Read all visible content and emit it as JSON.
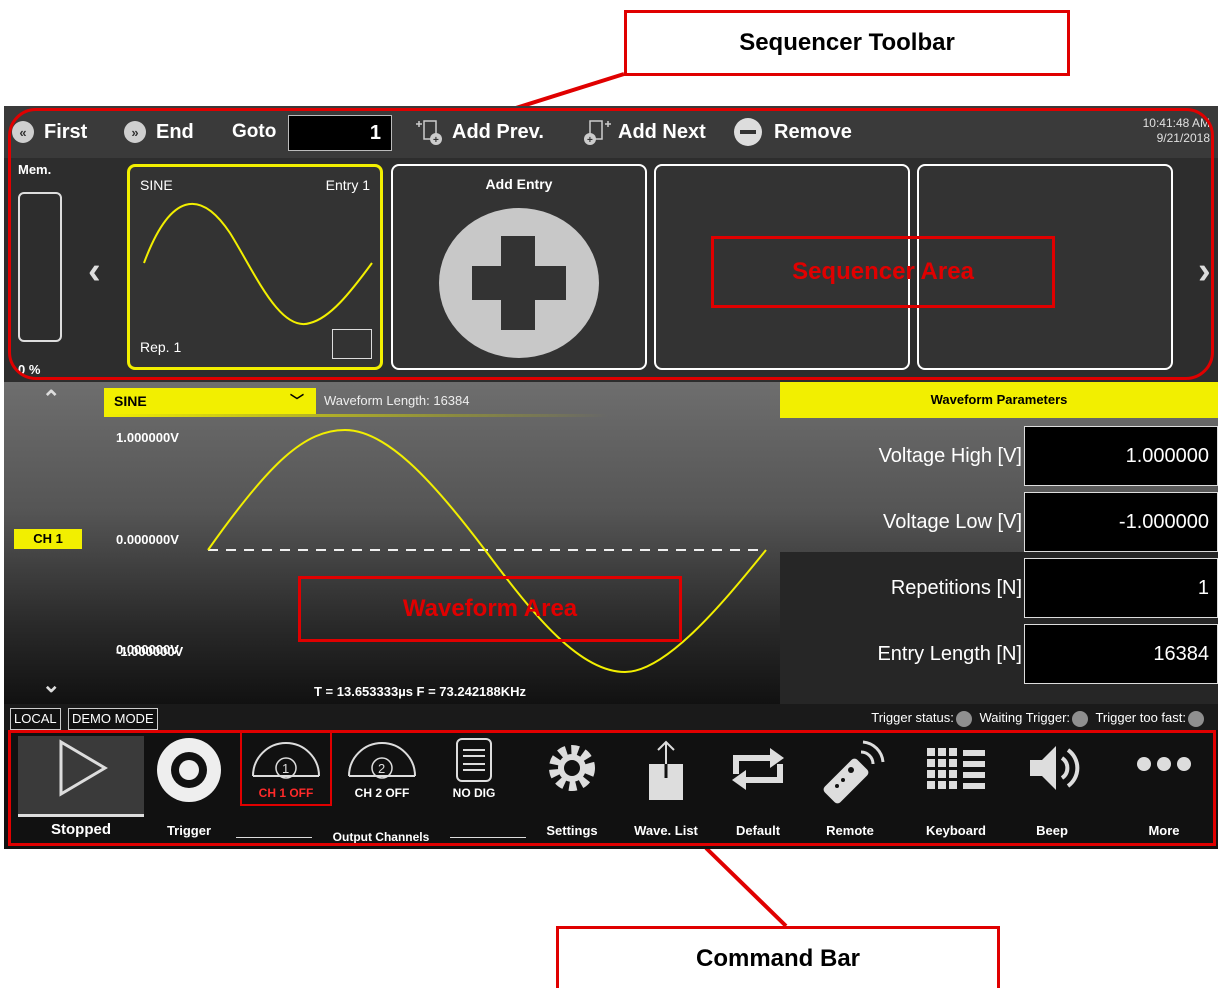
{
  "callouts": {
    "top": "Sequencer Toolbar",
    "bottom": "Command Bar",
    "sequencer_area": "Sequencer Area",
    "waveform_area": "Waveform Area"
  },
  "toolbar": {
    "first": "First",
    "end": "End",
    "goto_label": "Goto",
    "goto_value": "1",
    "add_prev": "Add Prev.",
    "add_next": "Add Next",
    "remove": "Remove",
    "time": "10:41:48 AM",
    "date": "9/21/2018"
  },
  "sequencer": {
    "mem_label": "Mem.",
    "mem_percent": "0 %",
    "entry_type": "SINE",
    "entry_name": "Entry 1",
    "entry_rep": "Rep. 1",
    "add_entry": "Add Entry"
  },
  "waveform": {
    "type": "SINE",
    "length_text": "Waveform Length: 16384",
    "v_high": "1.000000V",
    "v_zero": "0.000000V",
    "v_low": "-1.000000V",
    "channel": "CH 1",
    "period_freq": "T =  13.653333µs  F =  73.242188KHz"
  },
  "params": {
    "header": "Waveform Parameters",
    "rows": [
      {
        "label": "Voltage High [V]",
        "value": "1.000000"
      },
      {
        "label": "Voltage Low [V]",
        "value": "-1.000000"
      },
      {
        "label": "Repetitions [N]",
        "value": "1"
      },
      {
        "label": "Entry Length [N]",
        "value": "16384"
      }
    ]
  },
  "status": {
    "local": "LOCAL",
    "demo": "DEMO MODE",
    "trigger_status": "Trigger status:",
    "waiting": "Waiting Trigger:",
    "too_fast": "Trigger too fast:"
  },
  "command_bar": {
    "stopped": "Stopped",
    "trigger": "Trigger",
    "ch1_num": "1",
    "ch1": "CH 1 OFF",
    "ch2_num": "2",
    "ch2": "CH 2 OFF",
    "nodig": "NO DIG",
    "output_channels": "Output Channels",
    "settings": "Settings",
    "wave_list": "Wave. List",
    "default": "Default",
    "remote": "Remote",
    "keyboard": "Keyboard",
    "beep": "Beep",
    "more": "More"
  },
  "colors": {
    "accent_yellow": "#f2ef00",
    "annotation_red": "#e00000",
    "ch1_off_red": "#ff2a2a"
  }
}
